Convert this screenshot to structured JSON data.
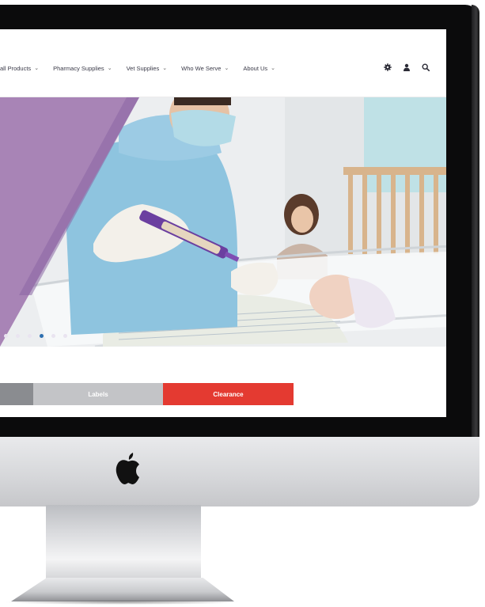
{
  "nav": {
    "items": [
      {
        "label": "all Products"
      },
      {
        "label": "Pharmacy Supplies"
      },
      {
        "label": "Vet Supplies"
      },
      {
        "label": "Who We Serve"
      },
      {
        "label": "About Us"
      }
    ],
    "chevron": "⌄"
  },
  "header_icons": [
    "gear-icon",
    "user-icon",
    "search-icon"
  ],
  "hero": {
    "accent_color": "#a884b6",
    "slides_total": 5,
    "active_slide": 3
  },
  "categories": [
    {
      "label": "",
      "color": "#8a8c90"
    },
    {
      "label": "Labels",
      "color": "#c3c4c7"
    },
    {
      "label": "Clearance",
      "color": "#e43a31"
    }
  ]
}
